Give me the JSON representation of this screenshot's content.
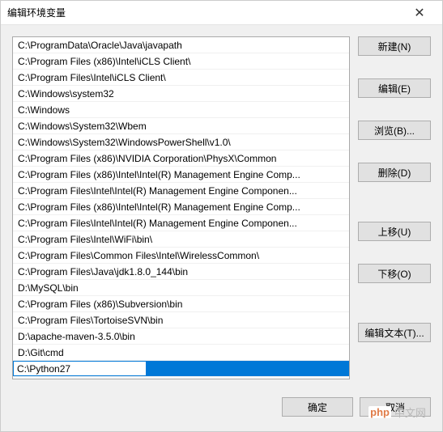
{
  "window": {
    "title": "编辑环境变量"
  },
  "list": {
    "items": [
      "C:\\ProgramData\\Oracle\\Java\\javapath",
      "C:\\Program Files (x86)\\Intel\\iCLS Client\\",
      "C:\\Program Files\\Intel\\iCLS Client\\",
      "C:\\Windows\\system32",
      "C:\\Windows",
      "C:\\Windows\\System32\\Wbem",
      "C:\\Windows\\System32\\WindowsPowerShell\\v1.0\\",
      "C:\\Program Files (x86)\\NVIDIA Corporation\\PhysX\\Common",
      "C:\\Program Files (x86)\\Intel\\Intel(R) Management Engine Comp...",
      "C:\\Program Files\\Intel\\Intel(R) Management Engine Componen...",
      "C:\\Program Files (x86)\\Intel\\Intel(R) Management Engine Comp...",
      "C:\\Program Files\\Intel\\Intel(R) Management Engine Componen...",
      "C:\\Program Files\\Intel\\WiFi\\bin\\",
      "C:\\Program Files\\Common Files\\Intel\\WirelessCommon\\",
      "C:\\Program Files\\Java\\jdk1.8.0_144\\bin",
      "D:\\MySQL\\bin",
      "C:\\Program Files (x86)\\Subversion\\bin",
      "C:\\Program Files\\TortoiseSVN\\bin",
      "D:\\apache-maven-3.5.0\\bin",
      "D:\\Git\\cmd"
    ],
    "editing_value": "C:\\Python27"
  },
  "buttons": {
    "new": "新建(N)",
    "edit": "编辑(E)",
    "browse": "浏览(B)...",
    "delete": "删除(D)",
    "move_up": "上移(U)",
    "move_down": "下移(O)",
    "edit_text": "编辑文本(T)...",
    "ok": "确定",
    "cancel": "取消"
  },
  "watermark": {
    "php": "php",
    "text": "中文网"
  }
}
